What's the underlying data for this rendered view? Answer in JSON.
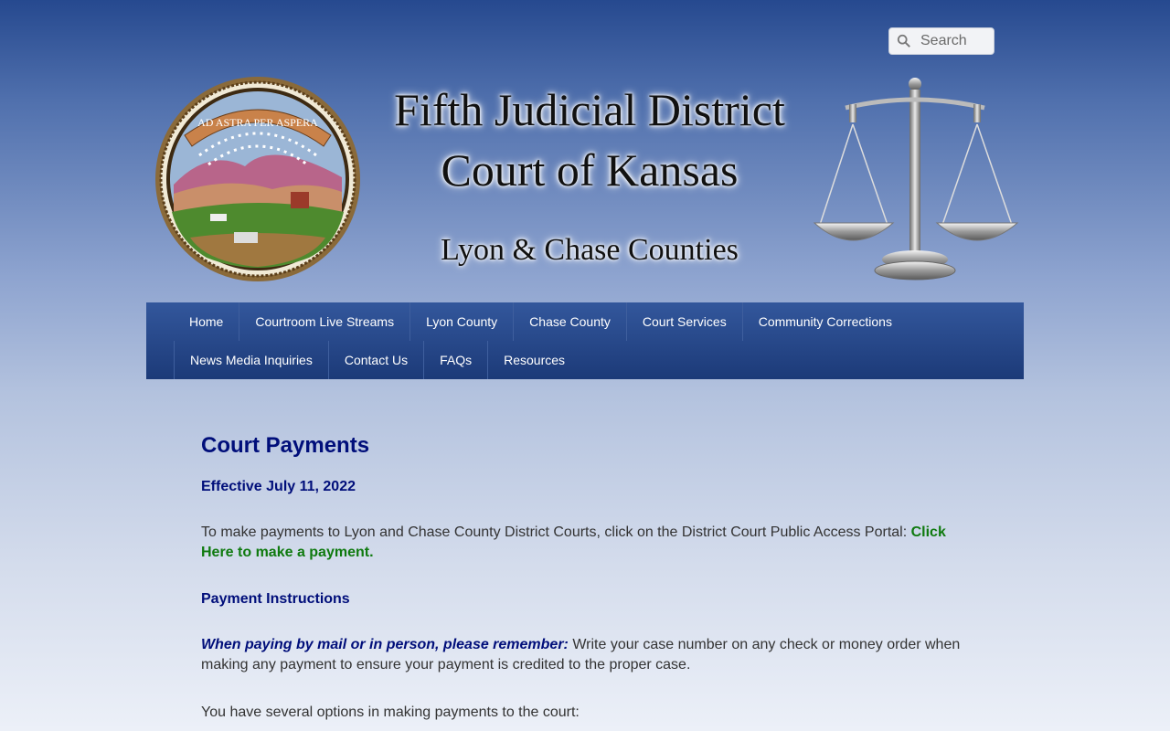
{
  "search": {
    "placeholder": "Search"
  },
  "banner": {
    "line1": "Fifth Judicial District",
    "line2": "Court of Kansas",
    "line3": "Lyon & Chase Counties",
    "seal_motto": "AD ASTRA PER ASPERA"
  },
  "nav": {
    "row1": [
      "Home",
      "Courtroom Live Streams",
      "Lyon County",
      "Chase County",
      "Court Services",
      "Community Corrections"
    ],
    "row2": [
      "News Media Inquiries",
      "Contact Us",
      "FAQs",
      "Resources"
    ]
  },
  "content": {
    "title": "Court Payments",
    "effective": "Effective July 11, 2022",
    "intro": "To make payments to Lyon and Chase County District Courts, click on the District Court Public Access Portal: ",
    "intro_link": "Click Here to make a payment.",
    "instructions_heading": "Payment Instructions",
    "reminder_lead": "When paying by mail or in person, please remember:",
    "reminder_text": " Write your case number on any check or money order when making any payment to ensure your payment is credited to the proper case.",
    "options_text": "You have several options in making payments to the court:"
  },
  "colors": {
    "heading": "#000e7a",
    "link": "#0f7a0f",
    "nav_bg": "#1c3a78"
  }
}
